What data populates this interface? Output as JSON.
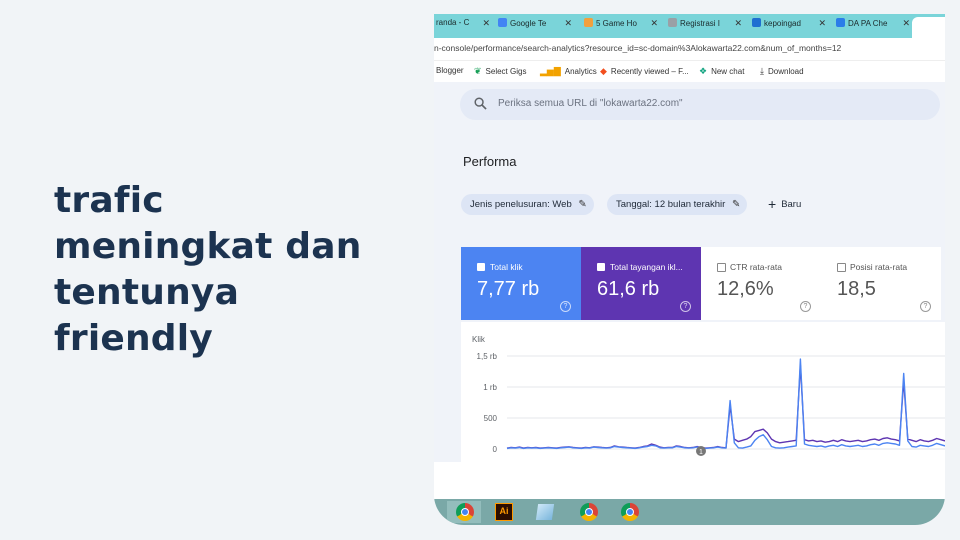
{
  "headline": [
    "trafic",
    "meningkat dan",
    "tentunya",
    "friendly"
  ],
  "browser": {
    "tabs": [
      {
        "label": "randa - C",
        "color": "#fbbc05"
      },
      {
        "label": "Google Te",
        "color": "#4285f4"
      },
      {
        "label": "5 Game Ho",
        "color": "#f2a03d"
      },
      {
        "label": "Registrasi I",
        "color": "#9aa0a6"
      },
      {
        "label": "kepoingad",
        "color": "#1f6fd1"
      },
      {
        "label": "DA PA Che",
        "color": "#2b7de9"
      }
    ],
    "tab_close": "✕",
    "url": "n-console/performance/search-analytics?resource_id=sc-domain%3Alokawarta22.com&num_of_months=12",
    "bookmarks": [
      {
        "label": "Blogger",
        "icon": ""
      },
      {
        "label": "Select Gigs",
        "icon": "leaf-icon"
      },
      {
        "label": "Analytics",
        "icon": "bar-chart-icon"
      },
      {
        "label": "Recently viewed – F...",
        "icon": "figma-icon"
      },
      {
        "label": "New chat",
        "icon": "chat-icon"
      },
      {
        "label": "Download",
        "icon": "download-icon"
      }
    ]
  },
  "console": {
    "search_placeholder": "Periksa semua URL di \"lokawarta22.com\"",
    "title": "Performa",
    "filters": [
      {
        "label": "Jenis penelusuran: Web"
      },
      {
        "label": "Tanggal: 12 bulan terakhir"
      }
    ],
    "new_label": "Baru",
    "metrics": [
      {
        "label": "Total klik",
        "value": "7,77 rb",
        "checked": true,
        "color": "#4c84f2"
      },
      {
        "label": "Total tayangan ikl...",
        "value": "61,6 rb",
        "checked": true,
        "color": "#5e35b1"
      },
      {
        "label": "CTR rata-rata",
        "value": "12,6%",
        "checked": false
      },
      {
        "label": "Posisi rata-rata",
        "value": "18,5",
        "checked": false
      }
    ],
    "help_glyph": "?"
  },
  "chart_data": {
    "type": "line",
    "ylabel": "Klik",
    "yticks": [
      "1,5 rb",
      "1 rb",
      "500",
      "0"
    ],
    "ylim": [
      0,
      1500
    ],
    "grid": true,
    "annotation_marker": "1",
    "series": [
      {
        "color": "#4c84f2",
        "values": [
          10,
          20,
          15,
          25,
          10,
          20,
          15,
          20,
          10,
          15,
          20,
          15,
          10,
          20,
          25,
          30,
          20,
          15,
          10,
          20,
          15,
          30,
          25,
          20,
          15,
          20,
          40,
          30,
          25,
          20,
          15,
          10,
          20,
          30,
          40,
          60,
          50,
          20,
          15,
          20,
          20,
          40,
          30,
          20,
          15,
          20,
          30,
          20,
          10,
          15,
          20,
          30,
          20,
          15,
          780,
          100,
          20,
          15,
          30,
          50,
          140,
          200,
          230,
          150,
          40,
          20,
          15,
          20,
          30,
          40,
          50,
          1450,
          80,
          60,
          50,
          40,
          50,
          30,
          50,
          60,
          40,
          70,
          50,
          40,
          50,
          60,
          40,
          50,
          70,
          80,
          60,
          90,
          100,
          90,
          80,
          60,
          1220,
          130,
          40,
          30,
          60,
          50,
          40,
          60,
          90,
          70,
          50
        ]
      },
      {
        "color": "#5e35b1",
        "values": [
          15,
          25,
          20,
          30,
          15,
          25,
          20,
          25,
          15,
          20,
          25,
          20,
          15,
          25,
          30,
          35,
          25,
          20,
          15,
          25,
          20,
          35,
          30,
          25,
          20,
          25,
          50,
          35,
          30,
          25,
          20,
          15,
          25,
          40,
          50,
          80,
          60,
          30,
          20,
          25,
          25,
          50,
          40,
          25,
          20,
          25,
          40,
          25,
          15,
          20,
          25,
          40,
          25,
          20,
          700,
          160,
          120,
          140,
          160,
          200,
          280,
          300,
          320,
          260,
          160,
          120,
          100,
          110,
          120,
          130,
          140,
          1350,
          150,
          130,
          140,
          120,
          130,
          110,
          120,
          140,
          120,
          150,
          130,
          120,
          130,
          140,
          120,
          130,
          150,
          160,
          140,
          170,
          180,
          160,
          150,
          130,
          1100,
          160,
          140,
          120,
          150,
          130,
          120,
          140,
          170,
          150,
          130
        ]
      }
    ]
  }
}
